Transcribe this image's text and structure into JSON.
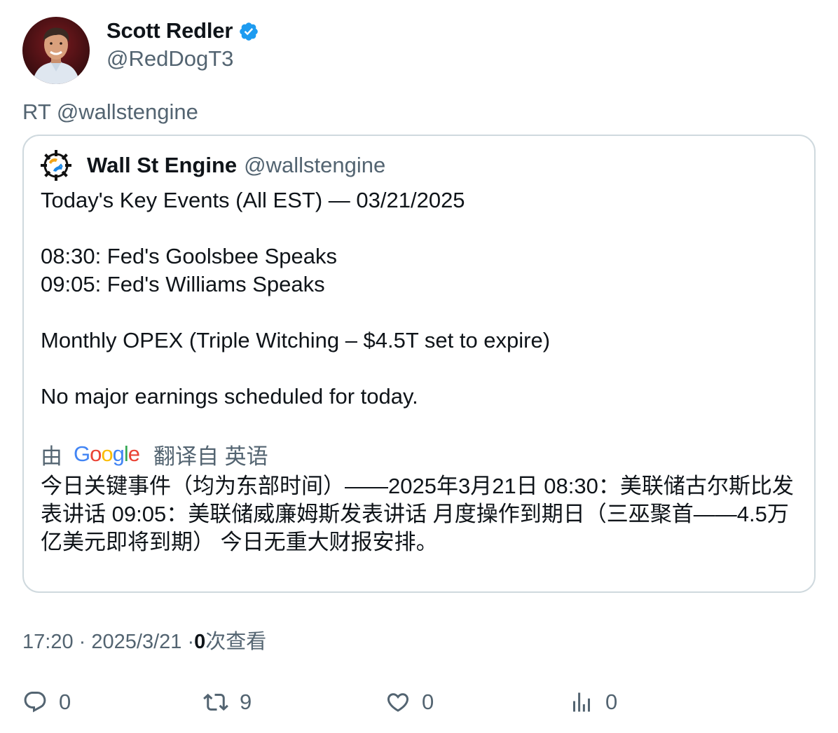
{
  "author": {
    "display_name": "Scott Redler",
    "handle": "@RedDogT3",
    "avatar_icon": "avatar",
    "verified_icon": "verified-badge-icon",
    "verified_color": "#1d9bf0"
  },
  "retweet_text": "RT @wallstengine",
  "quoted": {
    "display_name": "Wall St Engine",
    "handle": "@wallstengine",
    "logo_icon": "wall-st-engine-logo",
    "lines": [
      "Today's Key Events (All EST) — 03/21/2025",
      "",
      "08:30: Fed's Goolsbee Speaks",
      "09:05: Fed's Williams Speaks",
      "",
      "Monthly OPEX (Triple Witching – $4.5T set to expire)",
      "",
      "No major earnings scheduled for today."
    ],
    "translation": {
      "prefix": "由",
      "brand": "Google",
      "brand_colors": [
        "#4285F4",
        "#EA4335",
        "#FBBC05",
        "#4285F4",
        "#34A853",
        "#EA4335"
      ],
      "suffix": "翻译自 英语",
      "text": "今日关键事件（均为东部时间）——2025年3月21日 08:30：美联储古尔斯比发表讲话 09:05：美联储威廉姆斯发表讲话 月度操作到期日（三巫聚首——4.5万亿美元即将到期） 今日无重大财报安排。"
    }
  },
  "meta": {
    "time": "17:20",
    "separator": "·",
    "date": "2025/3/21",
    "views_count": "0",
    "views_label": "次查看"
  },
  "actions": {
    "reply": {
      "icon": "reply-icon",
      "count": "0"
    },
    "retweet": {
      "icon": "retweet-icon",
      "count": "9"
    },
    "like": {
      "icon": "heart-icon",
      "count": "0"
    },
    "views": {
      "icon": "analytics-icon",
      "count": "0"
    }
  },
  "colors": {
    "text_primary": "#0f1419",
    "text_secondary": "#536471",
    "border": "#cfd9de"
  }
}
